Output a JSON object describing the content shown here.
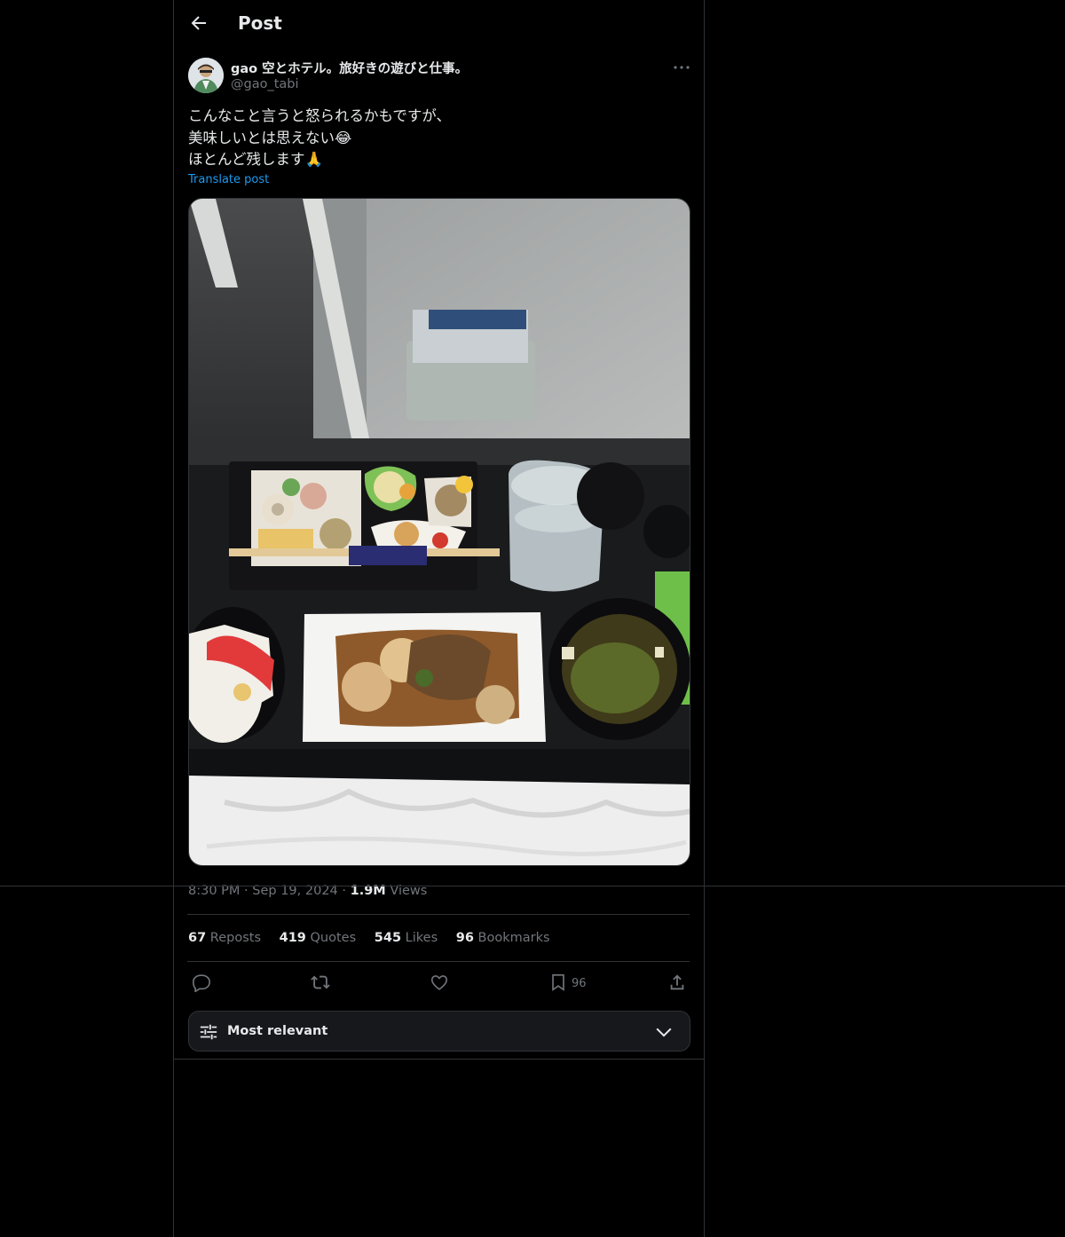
{
  "header": {
    "title": "Post"
  },
  "post": {
    "author_name": "gao 空とホテル。旅好きの遊びと仕事。",
    "author_handle": "@gao_tabi",
    "text": "こんなこと言うと怒られるかもですが、\n美味しいとは思えない😂\nほとんど残します🙏",
    "translate_label": "Translate post",
    "time": "8:30 PM",
    "date": "Sep 19, 2024",
    "views_count": "1.9M",
    "views_label": "Views"
  },
  "stats": {
    "reposts_count": "67",
    "reposts_label": "Reposts",
    "quotes_count": "419",
    "quotes_label": "Quotes",
    "likes_count": "545",
    "likes_label": "Likes",
    "bookmarks_count": "96",
    "bookmarks_label": "Bookmarks"
  },
  "actions": {
    "bookmark_count": "96"
  },
  "sort": {
    "label": "Most relevant"
  },
  "icons": [
    "back-arrow-icon",
    "more-icon",
    "reply-icon",
    "repost-icon",
    "like-icon",
    "bookmark-icon",
    "share-icon",
    "sort-sliders-icon",
    "chevron-down-icon"
  ]
}
